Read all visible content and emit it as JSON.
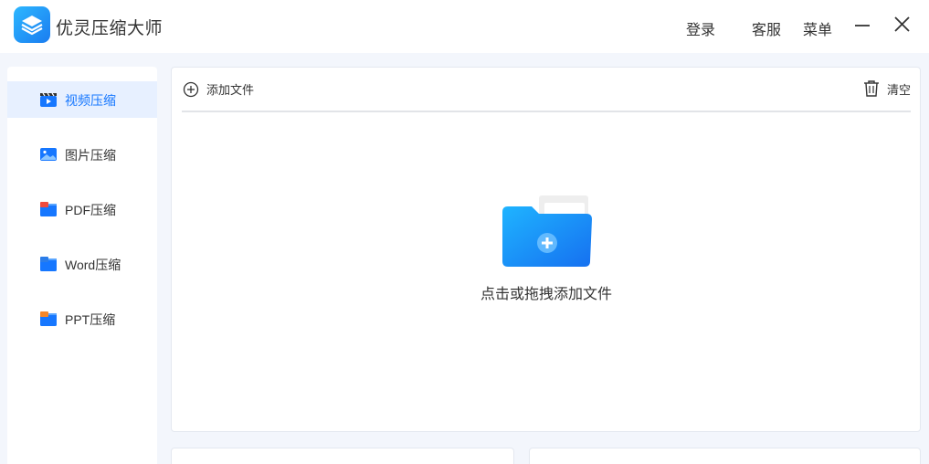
{
  "app": {
    "title": "优灵压缩大师"
  },
  "header": {
    "login": "登录",
    "service": "客服",
    "menu": "菜单"
  },
  "sidebar": {
    "items": [
      {
        "label": "视频压缩",
        "icon": "video-clapper-icon",
        "active": true
      },
      {
        "label": "图片压缩",
        "icon": "image-icon",
        "active": false
      },
      {
        "label": "PDF压缩",
        "icon": "pdf-file-icon",
        "active": false
      },
      {
        "label": "Word压缩",
        "icon": "word-file-icon",
        "active": false
      },
      {
        "label": "PPT压缩",
        "icon": "ppt-file-icon",
        "active": false
      }
    ]
  },
  "toolbar": {
    "add_file": "添加文件",
    "clear": "清空"
  },
  "dropzone": {
    "text": "点击或拖拽添加文件"
  },
  "colors": {
    "accent": "#1677ff",
    "active_bg": "#e7f0ff",
    "page_bg": "#f3f6fc"
  }
}
